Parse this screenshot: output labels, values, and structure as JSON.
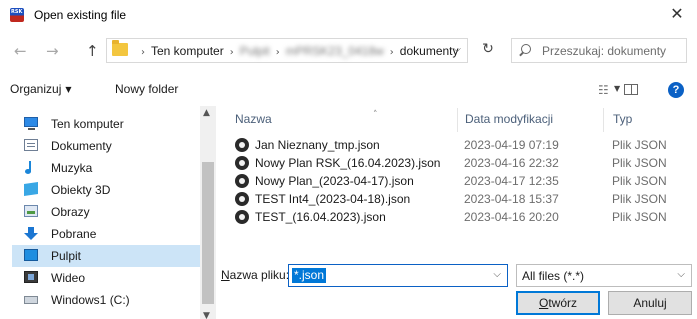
{
  "window": {
    "title": "Open existing file",
    "app_icon_text": "RSK",
    "close_glyph": "✕"
  },
  "navigation": {
    "back_icon": "←",
    "forward_icon": "→",
    "up_icon": "↑",
    "breadcrumb": [
      "Ten komputer",
      "Pulpit",
      "mPRSK23_0418w",
      "dokumenty"
    ],
    "breadcrumb_blurred": [
      false,
      true,
      true,
      false
    ],
    "refresh_icon": "↻",
    "search_placeholder": "Przeszukaj: dokumenty"
  },
  "toolbar": {
    "organize_label": "Organizuj",
    "new_folder_label": "Nowy folder",
    "help_label": "?"
  },
  "sidebar": {
    "items": [
      {
        "label": "Ten komputer",
        "icon": "computer-icon",
        "selected": false
      },
      {
        "label": "Dokumenty",
        "icon": "documents-icon",
        "selected": false
      },
      {
        "label": "Muzyka",
        "icon": "music-icon",
        "selected": false
      },
      {
        "label": "Obiekty 3D",
        "icon": "3d-objects-icon",
        "selected": false
      },
      {
        "label": "Obrazy",
        "icon": "pictures-icon",
        "selected": false
      },
      {
        "label": "Pobrane",
        "icon": "downloads-icon",
        "selected": false
      },
      {
        "label": "Pulpit",
        "icon": "desktop-icon",
        "selected": true
      },
      {
        "label": "Wideo",
        "icon": "videos-icon",
        "selected": false
      },
      {
        "label": "Windows1 (C:)",
        "icon": "drive-icon",
        "selected": false
      }
    ]
  },
  "file_list": {
    "columns": {
      "name": "Nazwa",
      "date": "Data modyfikacji",
      "type": "Typ"
    },
    "rows": [
      {
        "name": "Jan Nieznany_tmp.json",
        "date": "2023-04-19 07:19",
        "type": "Plik JSON"
      },
      {
        "name": "Nowy Plan RSK_(16.04.2023).json",
        "date": "2023-04-16 22:32",
        "type": "Plik JSON"
      },
      {
        "name": "Nowy Plan_(2023-04-17).json",
        "date": "2023-04-17 12:35",
        "type": "Plik JSON"
      },
      {
        "name": "TEST Int4_(2023-04-18).json",
        "date": "2023-04-18 15:37",
        "type": "Plik JSON"
      },
      {
        "name": "TEST_(16.04.2023).json",
        "date": "2023-04-16 20:20",
        "type": "Plik JSON"
      }
    ]
  },
  "footer": {
    "filename_label_prefix": "N",
    "filename_label_rest": "azwa pliku:",
    "filename_value": "*.json",
    "filter_value": "All files (*.*)",
    "open_button_prefix": "O",
    "open_button_rest": "twórz",
    "cancel_button": "Anuluj"
  },
  "colors": {
    "accent": "#0078d7",
    "selection": "#cce4f7",
    "header_text": "#4c607a"
  }
}
